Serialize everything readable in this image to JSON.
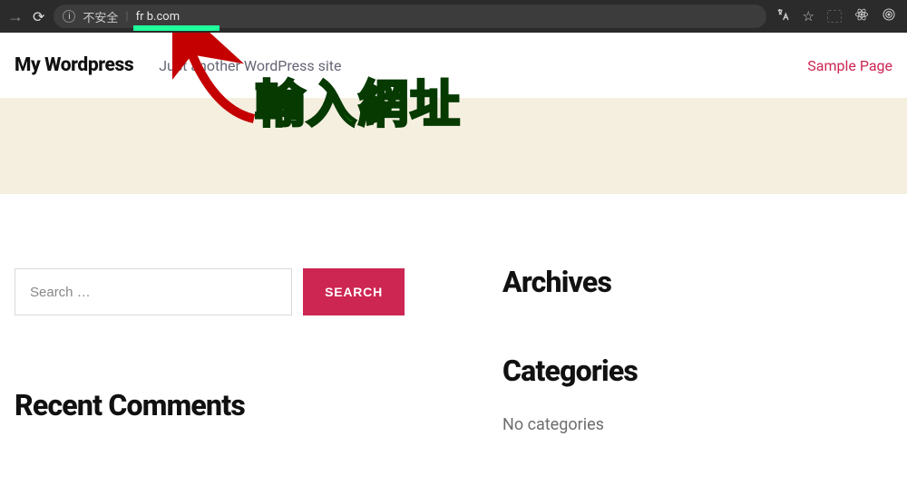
{
  "browser": {
    "nosecure_label": "不安全",
    "url_visible": "fr        b.com"
  },
  "header": {
    "site_title": "My Wordpress",
    "tagline": "Just another WordPress site",
    "nav": {
      "sample_page": "Sample Page"
    }
  },
  "search": {
    "placeholder": "Search …",
    "button_label": "SEARCH"
  },
  "sections": {
    "recent_comments": "Recent Comments",
    "archives": "Archives",
    "categories": "Categories",
    "no_categories": "No categories"
  },
  "annotation": {
    "text": "輸入網址"
  }
}
